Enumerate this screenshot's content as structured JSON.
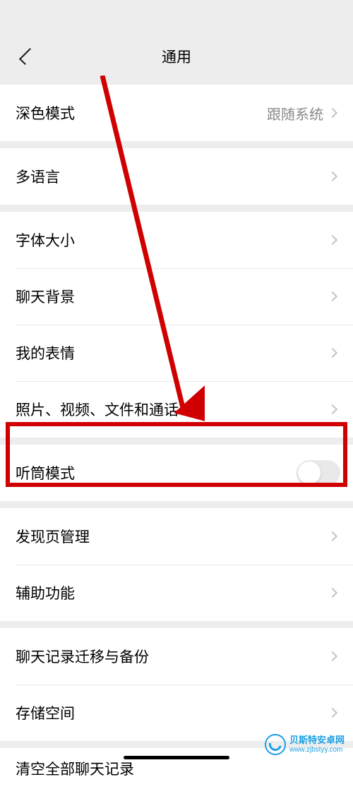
{
  "header": {
    "title": "通用"
  },
  "rows": {
    "dark_mode": {
      "label": "深色模式",
      "value": "跟随系统"
    },
    "language": {
      "label": "多语言"
    },
    "font_size": {
      "label": "字体大小"
    },
    "chat_bg": {
      "label": "聊天背景"
    },
    "my_emoji": {
      "label": "我的表情"
    },
    "media_files": {
      "label": "照片、视频、文件和通话"
    },
    "earpiece_mode": {
      "label": "听筒模式",
      "toggle": false
    },
    "discover_mgmt": {
      "label": "发现页管理"
    },
    "accessibility": {
      "label": "辅助功能"
    },
    "chat_migration": {
      "label": "聊天记录迁移与备份"
    },
    "storage": {
      "label": "存储空间"
    },
    "clear_all": {
      "label": "清空全部聊天记录"
    }
  },
  "watermark": {
    "line1": "贝斯特安卓网",
    "line2": "www.zjbstyy.com"
  },
  "annotation": {
    "highlight_color": "#d00000"
  }
}
